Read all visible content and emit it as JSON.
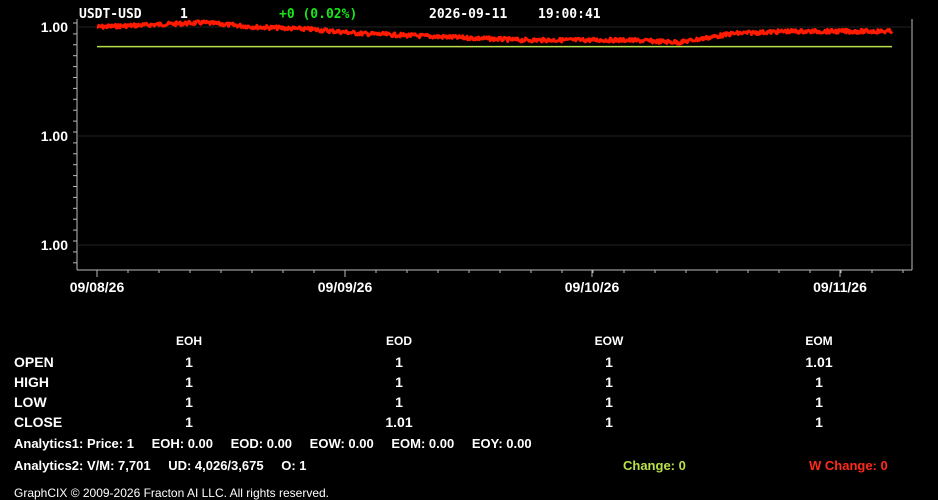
{
  "header": {
    "symbol": "USDT-USD",
    "interval": "1",
    "change": "+0 (0.02%)",
    "date": "2026-09-11",
    "time": "19:00:41"
  },
  "colors": {
    "price_line": "#ff1a00",
    "reference_line": "#b8e04a",
    "change_positive": "#19e619",
    "change_label": "#b8e04a",
    "w_change_label": "#ff2a1a",
    "background": "#000000",
    "grid": "#444444"
  },
  "chart_data": {
    "type": "line",
    "title": "USDT-USD",
    "y_tick_labels": [
      "1.00",
      "1.00",
      "1.00"
    ],
    "x_tick_labels": [
      "09/08/26",
      "09/09/26",
      "09/10/26",
      "09/11/26"
    ],
    "x_range": [
      "2026-09-08",
      "2026-09-11"
    ],
    "ylim": [
      0.99995,
      1.00005
    ],
    "grid": true,
    "series": [
      {
        "role": "price",
        "x": [
          "09/08 00:00",
          "09/08 06:00",
          "09/08 12:00",
          "09/08 18:00",
          "09/09 00:00",
          "09/09 06:00",
          "09/09 12:00",
          "09/09 18:00",
          "09/10 00:00",
          "09/10 06:00",
          "09/10 12:00",
          "09/10 18:00",
          "09/11 00:00",
          "09/11 06:00",
          "09/11 12:00",
          "09/11 19:00"
        ],
        "values": [
          1.00005,
          1.000051,
          1.000052,
          1.00005,
          1.000049,
          1.000047,
          1.000046,
          1.000045,
          1.000044,
          1.000044,
          1.000044,
          1.000043,
          1.000047,
          1.000048,
          1.000048,
          1.000048
        ]
      },
      {
        "role": "reference",
        "x": [
          "09/08 00:00",
          "09/11 19:00"
        ],
        "values": [
          1.000041,
          1.000041
        ]
      }
    ]
  },
  "table": {
    "columns": [
      "EOH",
      "EOD",
      "EOW",
      "EOM"
    ],
    "rows": [
      {
        "label": "OPEN",
        "values": [
          "1",
          "1",
          "1",
          "1.01"
        ]
      },
      {
        "label": "HIGH",
        "values": [
          "1",
          "1",
          "1",
          "1"
        ]
      },
      {
        "label": "LOW",
        "values": [
          "1",
          "1",
          "1",
          "1"
        ]
      },
      {
        "label": "CLOSE",
        "values": [
          "1",
          "1.01",
          "1",
          "1"
        ]
      }
    ]
  },
  "analytics1": {
    "price": "Analytics1: Price: 1",
    "eoh": "EOH: 0.00",
    "eod": "EOD: 0.00",
    "eow": "EOW: 0.00",
    "eom": "EOM: 0.00",
    "eoy": "EOY: 0.00"
  },
  "analytics2": {
    "vm": "Analytics2:  V/M: 7,701",
    "ud": "UD: 4,026/3,675",
    "o": "O: 1"
  },
  "change_label": "Change: 0",
  "w_change_label": "W Change: 0",
  "copyright": "GraphCIX © 2009-2026 Fracton AI LLC. All rights reserved."
}
